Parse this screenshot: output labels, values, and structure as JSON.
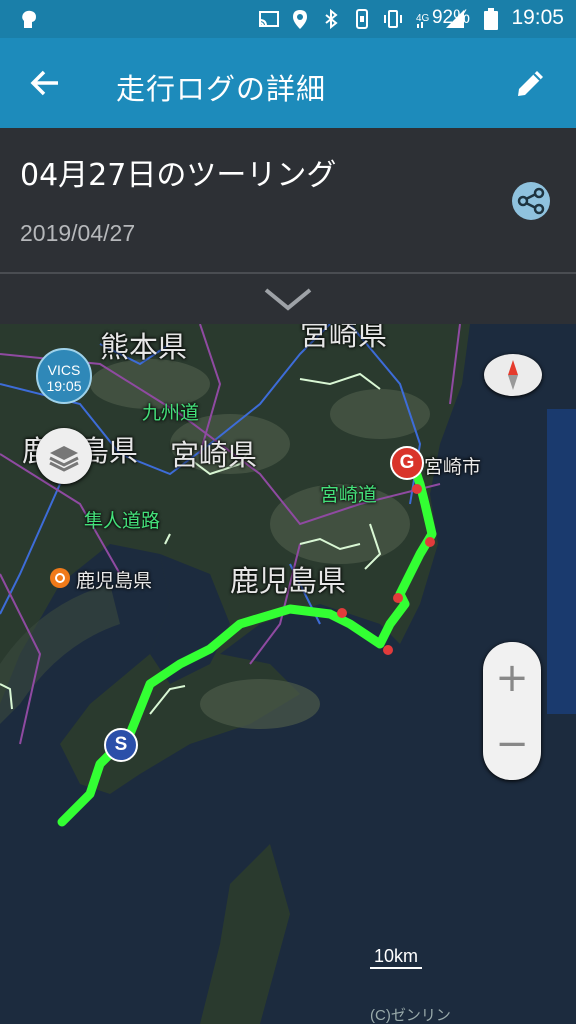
{
  "status": {
    "battery": "92%",
    "time": "19:05",
    "network": "4G"
  },
  "appbar": {
    "title": "走行ログの詳細"
  },
  "trip": {
    "title": "04月27日のツーリング",
    "date": "2019/04/27"
  },
  "map": {
    "prefectures": [
      "熊本県",
      "宮崎県",
      "鹿児島県",
      "宮崎県",
      "鹿児島県"
    ],
    "roads": [
      "九州道",
      "宮崎道",
      "隼人道路"
    ],
    "cities": [
      "宮崎市",
      "鹿児島県"
    ],
    "vics": {
      "label": "VICS",
      "time": "19:05"
    },
    "start_marker": "S",
    "goal_marker": "G",
    "scale": "10km",
    "copyright": "(C)ゼンリン",
    "zoom_in": "+",
    "zoom_out": "−"
  },
  "colors": {
    "appbar": "#1d8bbb",
    "route": "#33ff33",
    "panel": "#2d3035"
  }
}
